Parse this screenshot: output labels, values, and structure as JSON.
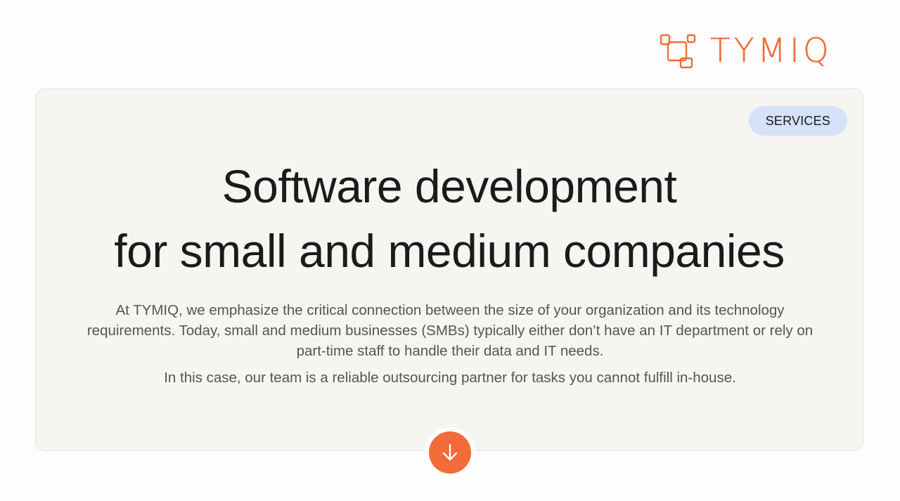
{
  "brand": {
    "name": "TYMIQ",
    "accent_color": "#f26b38"
  },
  "hero": {
    "tag_label": "SERVICES",
    "headline_line1": "Software development",
    "headline_line2": "for small and medium companies",
    "description": "At TYMIQ, we emphasize the critical connection between the size of your organization and its technology requirements. Today, small and medium businesses (SMBs) typically either don’t have an IT department or rely on part-time staff to handle their data and IT needs.",
    "description_secondary": "In this case, our team is a reliable outsourcing partner for tasks you cannot fulfill in-house.",
    "scroll_icon": "arrow-down-icon"
  },
  "colors": {
    "card_background": "#f7f5f2",
    "tag_background": "#d5e2f7",
    "text_primary": "#1b1b1b",
    "text_secondary": "#555555"
  }
}
